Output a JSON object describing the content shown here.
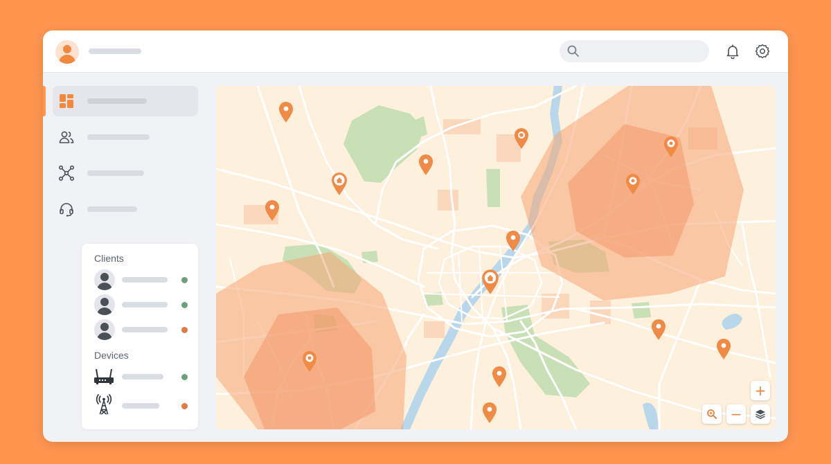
{
  "colors": {
    "background": "#ff9650",
    "accent": "#f3893f",
    "pin": "#f08a47",
    "online": "#6f9e7a",
    "offline": "#e07b47"
  },
  "header": {
    "avatar_icon": "user-avatar-icon",
    "search": {
      "placeholder": "",
      "icon": "search-icon"
    },
    "icons": [
      "bell-icon",
      "gear-icon"
    ]
  },
  "sidebar": {
    "items": [
      {
        "icon": "dashboard-icon",
        "active": true
      },
      {
        "icon": "users-icon",
        "active": false
      },
      {
        "icon": "network-icon",
        "active": false
      },
      {
        "icon": "headset-icon",
        "active": false
      }
    ]
  },
  "panel": {
    "clients_heading": "Clients",
    "clients": [
      {
        "icon": "person-icon",
        "status": "online"
      },
      {
        "icon": "person-icon",
        "status": "online"
      },
      {
        "icon": "person-icon",
        "status": "offline"
      }
    ],
    "devices_heading": "Devices",
    "devices": [
      {
        "icon": "router-icon",
        "status": "online"
      },
      {
        "icon": "antenna-tower-icon",
        "status": "offline"
      }
    ]
  },
  "map": {
    "pin_types": [
      "location-pin-icon",
      "home-pin-icon",
      "gear-pin-icon"
    ],
    "controls": {
      "zoom_in_label": "+",
      "zoom_out_label": "−",
      "icons": [
        "zoom-in-icon",
        "zoom-search-icon",
        "zoom-out-icon",
        "layers-icon"
      ]
    }
  }
}
